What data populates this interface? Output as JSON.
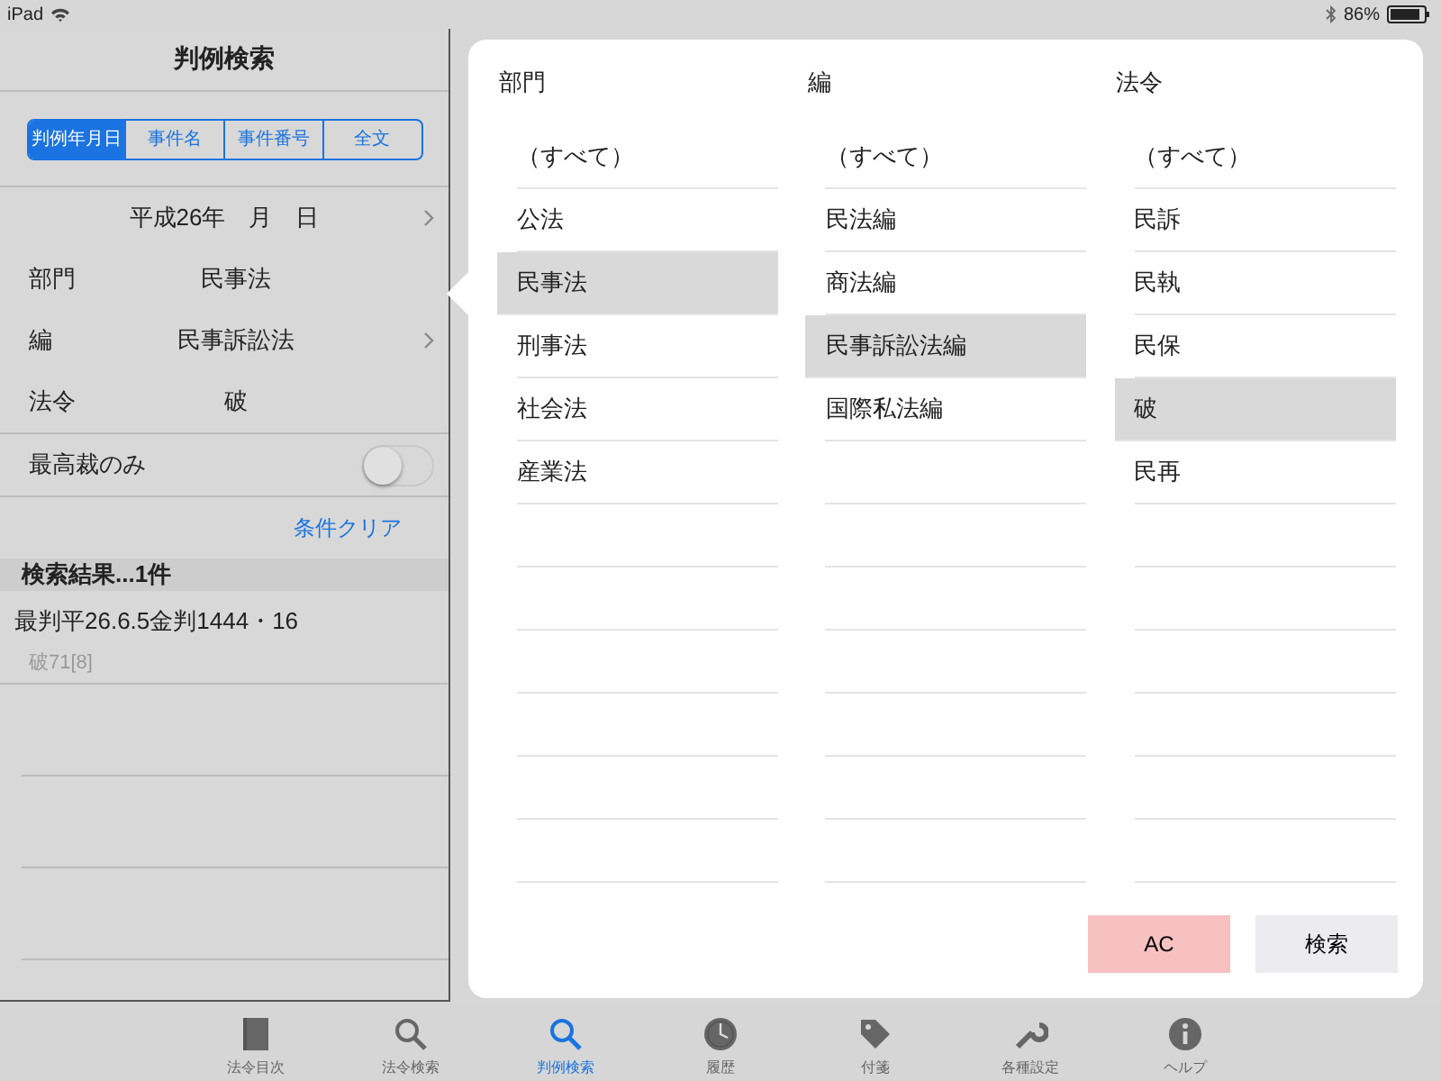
{
  "status_bar": {
    "device": "iPad",
    "battery": "86%"
  },
  "sidebar": {
    "title": "判例検索",
    "segments": [
      {
        "label": "判例年月日",
        "selected": true
      },
      {
        "label": "事件名",
        "selected": false
      },
      {
        "label": "事件番号",
        "selected": false
      },
      {
        "label": "全文",
        "selected": false
      }
    ],
    "date_row": {
      "value": "平成26年　月　日",
      "chevron": true
    },
    "filters": [
      {
        "label": "部門",
        "value": "民事法",
        "chevron": false
      },
      {
        "label": "編",
        "value": "民事訴訟法",
        "chevron": true
      },
      {
        "label": "法令",
        "value": "破",
        "chevron": false
      }
    ],
    "toggle": {
      "label": "最高裁のみ",
      "on": false
    },
    "clear_link": "条件クリア",
    "results_header": "検索結果...1件",
    "results": [
      {
        "title": "最判平26.6.5金判1444・16",
        "subtitle": "破71[8]"
      }
    ]
  },
  "popover": {
    "columns": [
      {
        "title": "部門",
        "items": [
          {
            "label": "（すべて）",
            "selected": false
          },
          {
            "label": "公法",
            "selected": false
          },
          {
            "label": "民事法",
            "selected": true
          },
          {
            "label": "刑事法",
            "selected": false
          },
          {
            "label": "社会法",
            "selected": false
          },
          {
            "label": "産業法",
            "selected": false
          }
        ]
      },
      {
        "title": "編",
        "items": [
          {
            "label": "（すべて）",
            "selected": false
          },
          {
            "label": "民法編",
            "selected": false
          },
          {
            "label": "商法編",
            "selected": false
          },
          {
            "label": "民事訴訟法編",
            "selected": true
          },
          {
            "label": "国際私法編",
            "selected": false
          }
        ]
      },
      {
        "title": "法令",
        "items": [
          {
            "label": "（すべて）",
            "selected": false
          },
          {
            "label": "民訴",
            "selected": false
          },
          {
            "label": "民執",
            "selected": false
          },
          {
            "label": "民保",
            "selected": false
          },
          {
            "label": "破",
            "selected": true
          },
          {
            "label": "民再",
            "selected": false
          }
        ]
      }
    ],
    "buttons": [
      {
        "label": "AC",
        "kind": "clear"
      },
      {
        "label": "検索",
        "kind": "search"
      }
    ]
  },
  "tab_bar": {
    "items": [
      {
        "label": "法令目次",
        "selected": false
      },
      {
        "label": "法令検索",
        "selected": false
      },
      {
        "label": "判例検索",
        "selected": true
      },
      {
        "label": "履歴",
        "selected": false
      },
      {
        "label": "付箋",
        "selected": false
      },
      {
        "label": "各種設定",
        "selected": false
      },
      {
        "label": "ヘルプ",
        "selected": false
      }
    ]
  }
}
